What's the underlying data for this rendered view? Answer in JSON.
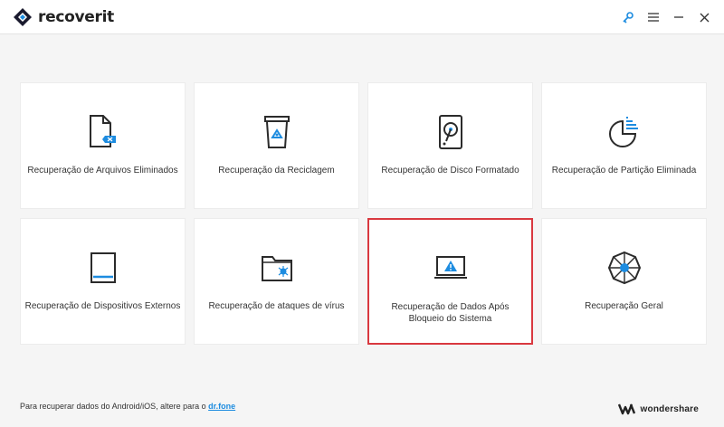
{
  "app": {
    "logo_text": "recoverit"
  },
  "titlebar": {
    "icons": [
      "key-icon",
      "menu-icon",
      "minimize-icon",
      "close-icon"
    ],
    "accent_color": "#1d8ce0"
  },
  "cards": [
    {
      "label": "Recuperação de Arquivos Eliminados",
      "icon": "deleted-file-icon"
    },
    {
      "label": "Recuperação da Reciclagem",
      "icon": "recycle-bin-icon"
    },
    {
      "label": "Recuperação de Disco Formatado",
      "icon": "formatted-disk-icon"
    },
    {
      "label": "Recuperação de Partição Eliminada",
      "icon": "partition-icon"
    },
    {
      "label": "Recuperação de Dispositivos Externos",
      "icon": "external-device-icon"
    },
    {
      "label": "Recuperação de ataques de vírus",
      "icon": "virus-folder-icon"
    },
    {
      "label": "Recuperação de Dados Após Bloqueio do Sistema",
      "icon": "system-crash-icon",
      "selected": true
    },
    {
      "label": "Recuperação Geral",
      "icon": "all-around-icon"
    }
  ],
  "footer": {
    "note": "Para recuperar dados do Android/iOS, altere para o",
    "link": "dr.fone",
    "brand": "wondershare"
  },
  "colors": {
    "selected_border": "#d9383f",
    "icon_stroke": "#2b2b2b",
    "icon_accent": "#1d8ce0"
  }
}
